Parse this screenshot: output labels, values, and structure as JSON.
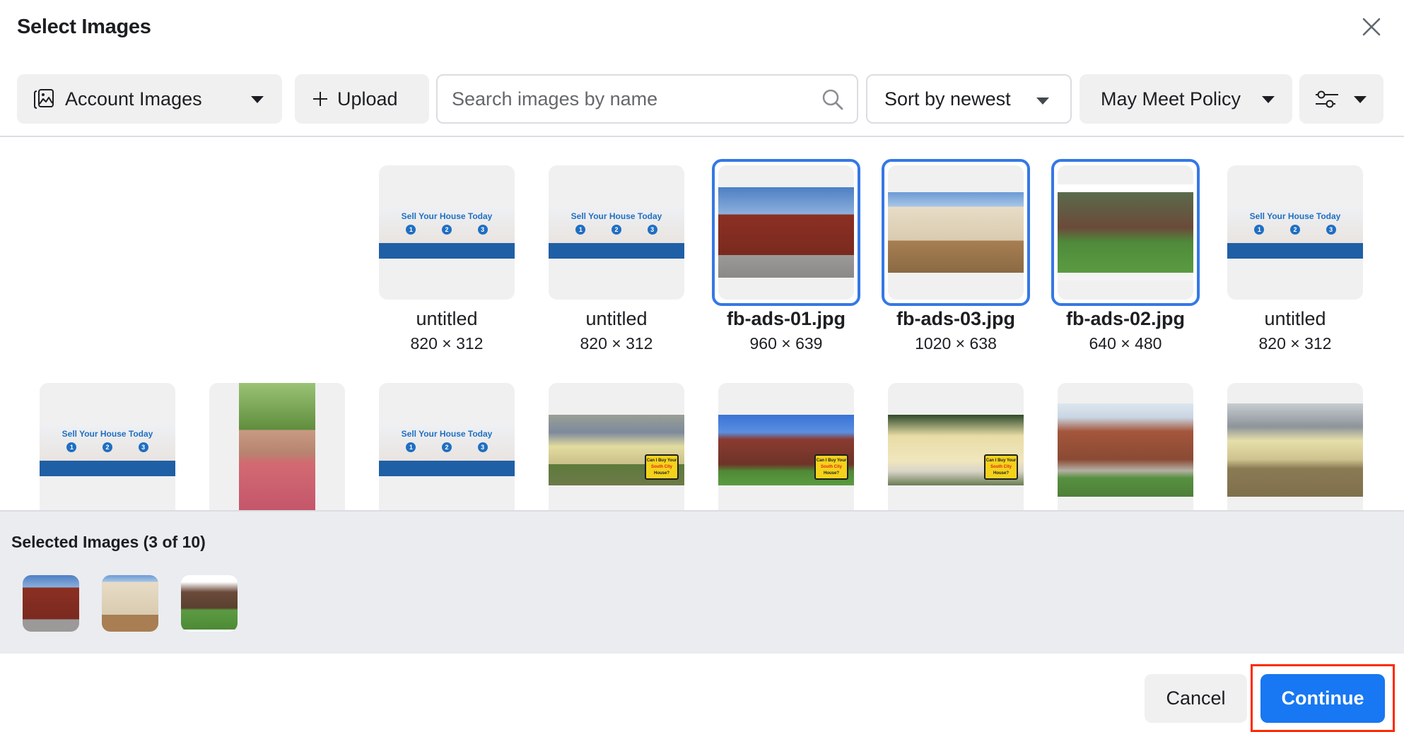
{
  "dialog": {
    "title": "Select Images",
    "close_icon": "close-icon"
  },
  "toolbar": {
    "account_images": {
      "label": "Account Images",
      "icon": "images-icon"
    },
    "upload": {
      "label": "Upload",
      "icon": "plus-icon"
    },
    "search": {
      "placeholder": "Search images by name",
      "value": "",
      "icon": "search-icon"
    },
    "sort": {
      "label": "Sort by newest"
    },
    "policy": {
      "label": "May Meet Policy"
    },
    "filter": {
      "icon": "filter-sliders-icon"
    }
  },
  "grid": {
    "rows": [
      [
        {
          "name": "untitled",
          "dims": "820 × 312",
          "selected": false,
          "kind": "banner"
        },
        {
          "name": "untitled",
          "dims": "820 × 312",
          "selected": false,
          "kind": "banner"
        },
        {
          "name": "fb-ads-01.jpg",
          "dims": "960 × 639",
          "selected": true,
          "kind": "brick-rowhouses"
        },
        {
          "name": "fb-ads-03.jpg",
          "dims": "1020 × 638",
          "selected": true,
          "kind": "cream-house"
        },
        {
          "name": "fb-ads-02.jpg",
          "dims": "640 × 480",
          "selected": true,
          "kind": "tudor-house"
        },
        {
          "name": "untitled",
          "dims": "820 × 312",
          "selected": false,
          "kind": "banner"
        }
      ],
      [
        {
          "kind": "banner"
        },
        {
          "kind": "person"
        },
        {
          "kind": "banner"
        },
        {
          "kind": "yellow-house-sign"
        },
        {
          "kind": "brick-house-sign"
        },
        {
          "kind": "cottage-sign"
        },
        {
          "kind": "brick-house"
        },
        {
          "kind": "yellow-house"
        }
      ]
    ],
    "banner_text": {
      "headline": "Sell Your House Today",
      "steps": [
        "1",
        "2",
        "3"
      ]
    },
    "sign_text": {
      "line1": "Can I Buy Your",
      "line2": "South City",
      "line3": "House?"
    }
  },
  "selected": {
    "title": "Selected Images (3 of 10)",
    "items": [
      "fb-ads-01.jpg",
      "fb-ads-03.jpg",
      "fb-ads-02.jpg"
    ]
  },
  "footer": {
    "cancel_label": "Cancel",
    "continue_label": "Continue",
    "accent_color": "#1877f2",
    "highlight_color": "#ff2a00"
  }
}
